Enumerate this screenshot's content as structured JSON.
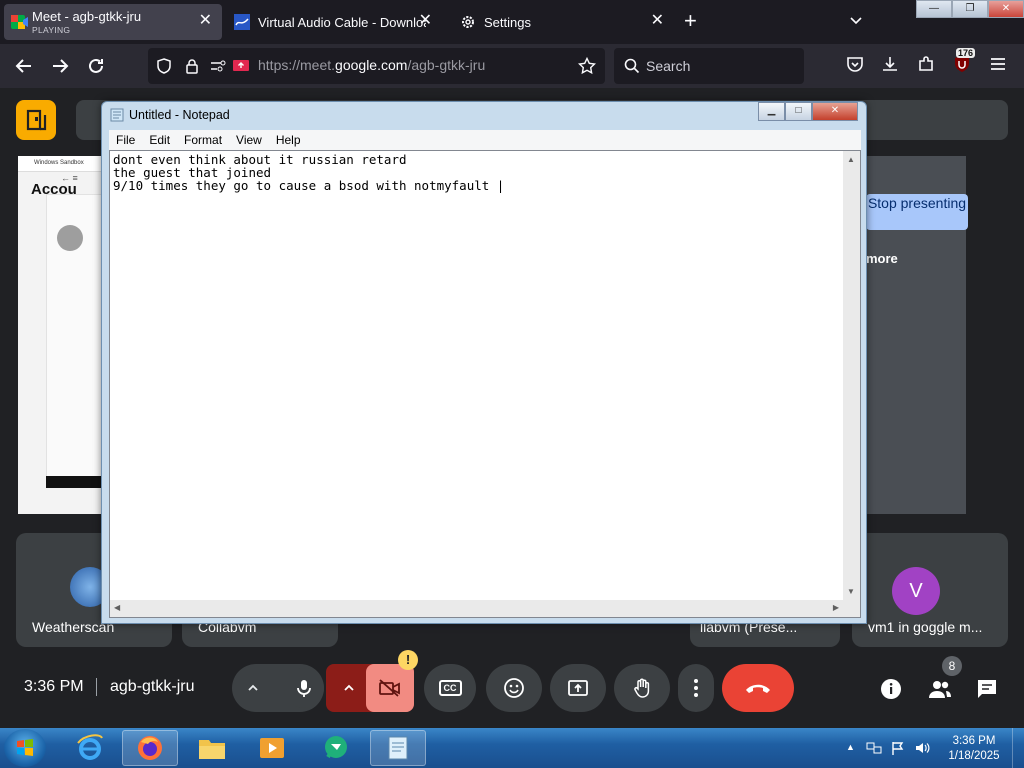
{
  "browser": {
    "tabs": [
      {
        "title": "Meet - agb-gtkk-jru",
        "status": "PLAYING"
      },
      {
        "title": "Virtual Audio Cable - Download"
      },
      {
        "title": "Settings"
      }
    ],
    "url": {
      "prefix": "https://meet.",
      "domain": "google.com",
      "path": "/agb-gtkk-jru"
    },
    "search_placeholder": "Search",
    "extension_badge": "176",
    "window_controls": {
      "minimize": "—",
      "maximize": "❐",
      "close": "✕"
    }
  },
  "meet": {
    "stop_presenting_label": "Stop presenting",
    "more_label": "more",
    "sandbox_title": "Windows Sandbox",
    "sandbox_heading": "Accou",
    "tiles": [
      {
        "name": "Weatherscan"
      },
      {
        "name": "Collabvm"
      },
      {
        "name": "llabvm (Prese..."
      },
      {
        "name": "vm1 in goggle m...",
        "avatar_letter": "V"
      }
    ],
    "time": "3:36 PM",
    "meeting_code": "agb-gtkk-jru",
    "people_count": "8",
    "camera_warning": "!",
    "cc_label": "CC",
    "colors": {
      "end_call": "#ea4335",
      "camera_off": "#f28b82",
      "logo": "#f9ab00",
      "avatar": "#a142c4"
    }
  },
  "notepad": {
    "title": "Untitled - Notepad",
    "menu": [
      "File",
      "Edit",
      "Format",
      "View",
      "Help"
    ],
    "lines": [
      "dont even think about it russian retard",
      "the guest that joined",
      "9/10 times they go to cause a bsod with notmyfault |"
    ]
  },
  "taskbar": {
    "clock_time": "3:36 PM",
    "clock_date": "1/18/2025",
    "apps": [
      "internet-explorer",
      "firefox",
      "file-explorer",
      "media-player",
      "meet-pwa",
      "notepad"
    ]
  }
}
